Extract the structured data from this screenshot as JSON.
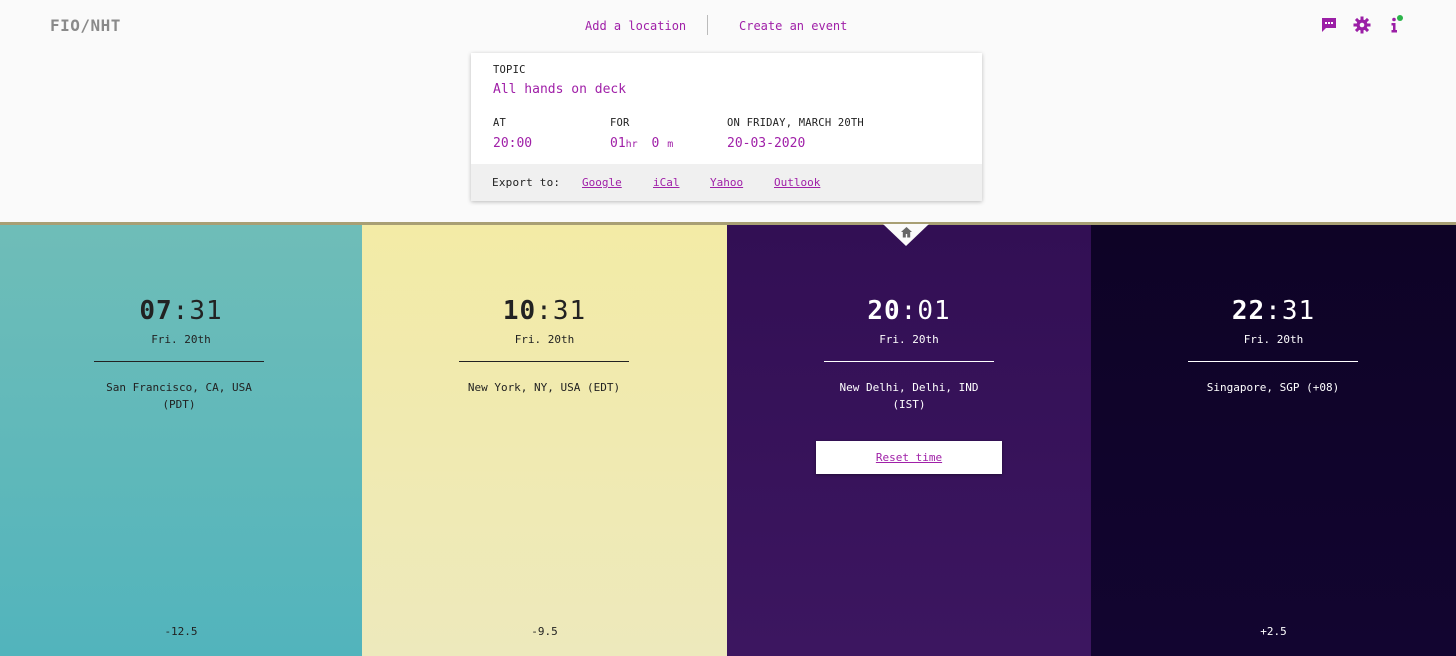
{
  "app": {
    "logo": "FIO/NHT"
  },
  "nav": {
    "add_location": "Add a location",
    "create_event": "Create an event"
  },
  "icons": {
    "feedback": "chat-icon",
    "settings": "gear-icon",
    "info": "info-icon",
    "home": "home-icon"
  },
  "colors": {
    "accent": "#a020a8",
    "status_dot": "#2bb44a"
  },
  "event": {
    "topic_label": "TOPIC",
    "topic_value": "All hands on deck",
    "at_label": "AT",
    "at_value": "20:00",
    "for_label": "FOR",
    "for_hours": "01",
    "for_hours_unit": "hr",
    "for_minutes": "0",
    "for_minutes_unit": "m",
    "date_label": "ON FRIDAY, MARCH 20TH",
    "date_value": "20-03-2020",
    "export_label": "Export to:",
    "export_links": [
      "Google",
      "iCal",
      "Yahoo",
      "Outlook"
    ]
  },
  "locations": [
    {
      "hour": "07",
      "minute": "31",
      "day": "Fri. 20th",
      "place_line1": "San Francisco, CA, USA",
      "place_line2": "(PDT)",
      "offset": "-12.5",
      "bg": "#5bb8b8",
      "fg": "#222222"
    },
    {
      "hour": "10",
      "minute": "31",
      "day": "Fri. 20th",
      "place_line1": "New York, NY, USA (EDT)",
      "place_line2": "",
      "offset": "-9.5",
      "bg": "#f0e8a8",
      "fg": "#222222"
    },
    {
      "hour": "20",
      "minute": "01",
      "day": "Fri. 20th",
      "place_line1": "New Delhi, Delhi, IND",
      "place_line2": "(IST)",
      "offset": "",
      "bg": "#361154",
      "fg": "#ffffff",
      "reset_label": "Reset time"
    },
    {
      "hour": "22",
      "minute": "31",
      "day": "Fri. 20th",
      "place_line1": "Singapore, SGP (+08)",
      "place_line2": "",
      "offset": "+2.5",
      "bg": "#0f0428",
      "fg": "#ffffff"
    }
  ]
}
